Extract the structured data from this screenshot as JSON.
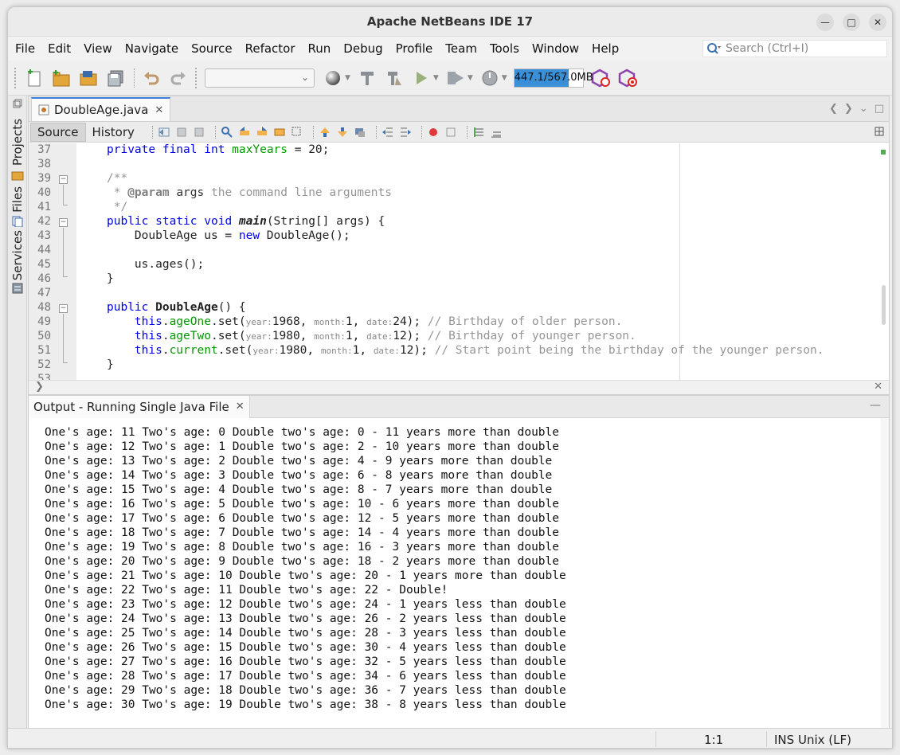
{
  "window": {
    "title": "Apache NetBeans IDE 17"
  },
  "menubar": {
    "items": [
      "File",
      "Edit",
      "View",
      "Navigate",
      "Source",
      "Refactor",
      "Run",
      "Debug",
      "Profile",
      "Team",
      "Tools",
      "Window",
      "Help"
    ],
    "search_placeholder": "Search (Ctrl+I)"
  },
  "toolbar": {
    "memory_text": "447.1/567.0MB",
    "memory_fill_fraction": 0.79,
    "config_dropdown_value": ""
  },
  "sidebar": {
    "tabs": [
      "Projects",
      "Files",
      "Services"
    ]
  },
  "editor": {
    "tab_name": "DoubleAge.java",
    "source_label": "Source",
    "history_label": "History",
    "line_numbers": [
      "37",
      "38",
      "39",
      "40",
      "41",
      "42",
      "43",
      "44",
      "45",
      "46",
      "47",
      "48",
      "49",
      "50",
      "51",
      "52",
      "53"
    ]
  },
  "code": {
    "l37": {
      "kw1": "private",
      "kw2": "final",
      "kw3": "int",
      "field": "maxYears",
      "rest": " = 20;"
    },
    "l39": "/**",
    "l40": {
      "prefix": " * ",
      "tag": "@param",
      "name": " args",
      "text": " the command line arguments"
    },
    "l41": " */",
    "l42": {
      "kw1": "public",
      "kw2": "static",
      "kw3": "void",
      "method": "main",
      "rest": "(String[] args) {"
    },
    "l43": {
      "pre": "    DoubleAge us = ",
      "kw": "new",
      "rest": " DoubleAge();"
    },
    "l45": "    us.ages();",
    "l46": "}",
    "l48": {
      "kw": "public",
      "method": "DoubleAge",
      "rest": "() {"
    },
    "l49": {
      "this": "this",
      "field": "ageOne",
      "call": ".set(",
      "h1": "year:",
      "v1": "1968, ",
      "h2": "month:",
      "v2": "1, ",
      "h3": "date:",
      "v3": "24); ",
      "comment": "// Birthday of older person."
    },
    "l50": {
      "this": "this",
      "field": "ageTwo",
      "call": ".set(",
      "h1": "year:",
      "v1": "1980, ",
      "h2": "month:",
      "v2": "1, ",
      "h3": "date:",
      "v3": "12); ",
      "comment": "// Birthday of younger person."
    },
    "l51": {
      "this": "this",
      "field": "current",
      "call": ".set(",
      "h1": "year:",
      "v1": "1980, ",
      "h2": "month:",
      "v2": "1, ",
      "h3": "date:",
      "v3": "12); ",
      "comment": "// Start point being the birthday of the younger person."
    },
    "l52": "}"
  },
  "output": {
    "tab_name": "Output - Running Single Java File",
    "lines": [
      "One's age: 11 Two's age: 0 Double two's age: 0 - 11 years more than double",
      "One's age: 12 Two's age: 1 Double two's age: 2 - 10 years more than double",
      "One's age: 13 Two's age: 2 Double two's age: 4 - 9 years more than double",
      "One's age: 14 Two's age: 3 Double two's age: 6 - 8 years more than double",
      "One's age: 15 Two's age: 4 Double two's age: 8 - 7 years more than double",
      "One's age: 16 Two's age: 5 Double two's age: 10 - 6 years more than double",
      "One's age: 17 Two's age: 6 Double two's age: 12 - 5 years more than double",
      "One's age: 18 Two's age: 7 Double two's age: 14 - 4 years more than double",
      "One's age: 19 Two's age: 8 Double two's age: 16 - 3 years more than double",
      "One's age: 20 Two's age: 9 Double two's age: 18 - 2 years more than double",
      "One's age: 21 Two's age: 10 Double two's age: 20 - 1 years more than double",
      "One's age: 22 Two's age: 11 Double two's age: 22 - Double!",
      "One's age: 23 Two's age: 12 Double two's age: 24 - 1 years less than double",
      "One's age: 24 Two's age: 13 Double two's age: 26 - 2 years less than double",
      "One's age: 25 Two's age: 14 Double two's age: 28 - 3 years less than double",
      "One's age: 26 Two's age: 15 Double two's age: 30 - 4 years less than double",
      "One's age: 27 Two's age: 16 Double two's age: 32 - 5 years less than double",
      "One's age: 28 Two's age: 17 Double two's age: 34 - 6 years less than double",
      "One's age: 29 Two's age: 18 Double two's age: 36 - 7 years less than double",
      "One's age: 30 Two's age: 19 Double two's age: 38 - 8 years less than double"
    ]
  },
  "statusbar": {
    "position": "1:1",
    "mode": "INS",
    "line_ending": "Unix (LF)"
  },
  "colors": {
    "keyword": "#0000e6",
    "field": "#009900",
    "comment": "#969696",
    "accent": "#3a8fd6"
  }
}
